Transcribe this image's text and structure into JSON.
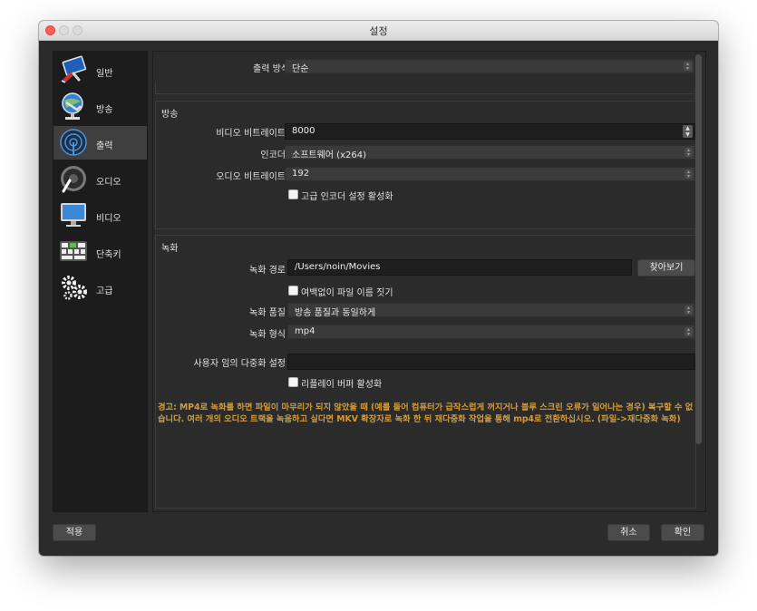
{
  "window": {
    "title": "설정"
  },
  "sidebar": {
    "items": [
      {
        "label": "일반",
        "icon": "general-icon"
      },
      {
        "label": "방송",
        "icon": "broadcast-icon"
      },
      {
        "label": "출력",
        "icon": "output-icon",
        "active": true
      },
      {
        "label": "오디오",
        "icon": "audio-icon"
      },
      {
        "label": "비디오",
        "icon": "video-icon"
      },
      {
        "label": "단축키",
        "icon": "hotkeys-icon"
      },
      {
        "label": "고급",
        "icon": "advanced-icon"
      }
    ]
  },
  "output": {
    "mode_label": "출력 방식",
    "mode_value": "단순"
  },
  "streaming": {
    "title": "방송",
    "video_bitrate_label": "비디오 비트레이트",
    "video_bitrate_value": "8000",
    "encoder_label": "인코더",
    "encoder_value": "소프트웨어 (x264)",
    "audio_bitrate_label": "오디오 비트레이트",
    "audio_bitrate_value": "192",
    "advanced_encoder_label": "고급 인코더 설정 활성화",
    "advanced_encoder_checked": false
  },
  "recording": {
    "title": "녹화",
    "path_label": "녹화 경로",
    "path_value": "/Users/noin/Movies",
    "browse_label": "찾아보기",
    "no_space_label": "여백없이 파일 이름 짓기",
    "no_space_checked": false,
    "quality_label": "녹화 품질",
    "quality_value": "방송 품질과 동일하게",
    "format_label": "녹화 형식",
    "format_value": "mp4",
    "muxer_label": "사용자 임의 다중화 설정",
    "muxer_value": "",
    "replay_buffer_label": "리플레이 버퍼 활성화",
    "replay_buffer_checked": false,
    "warning": "경고: MP4로 녹화를 하면 파일이 마무리가 되지 않았을 때 (예를 들어 컴퓨터가 급작스럽게 꺼지거나 블루 스크린 오류가 일어나는 경우) 복구할 수 없습니다. 여러 개의 오디오 트랙을 녹음하고 싶다면 MKV 확장자로 녹화 한 뒤 재다중화 작업을 통해 mp4로 전환하십시오. (파일->재다중화 녹화)"
  },
  "footer": {
    "apply_label": "적용",
    "cancel_label": "취소",
    "ok_label": "확인"
  },
  "colors": {
    "window_bg": "#2b2b2b",
    "sidebar_bg": "#1c1c1c",
    "warning_text": "#d29b3d",
    "close_button": "#fc5f57"
  }
}
